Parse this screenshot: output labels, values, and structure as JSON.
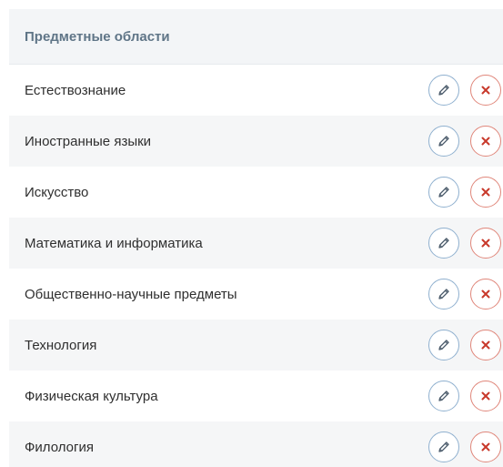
{
  "table": {
    "header": "Предметные области",
    "rows": [
      {
        "label": "Естествознание"
      },
      {
        "label": "Иностранные языки"
      },
      {
        "label": "Искусство"
      },
      {
        "label": "Математика и информатика"
      },
      {
        "label": "Общественно-научные предметы"
      },
      {
        "label": "Технология"
      },
      {
        "label": "Физическая культура"
      },
      {
        "label": "Филология"
      }
    ]
  },
  "icons": {
    "edit": "pencil-icon",
    "delete": "close-icon"
  },
  "colors": {
    "header_bg": "#f3f5f7",
    "header_text": "#5f7587",
    "edit_accent": "#8fb0cf",
    "delete_accent": "#e0867a",
    "delete_x": "#c8392b"
  }
}
